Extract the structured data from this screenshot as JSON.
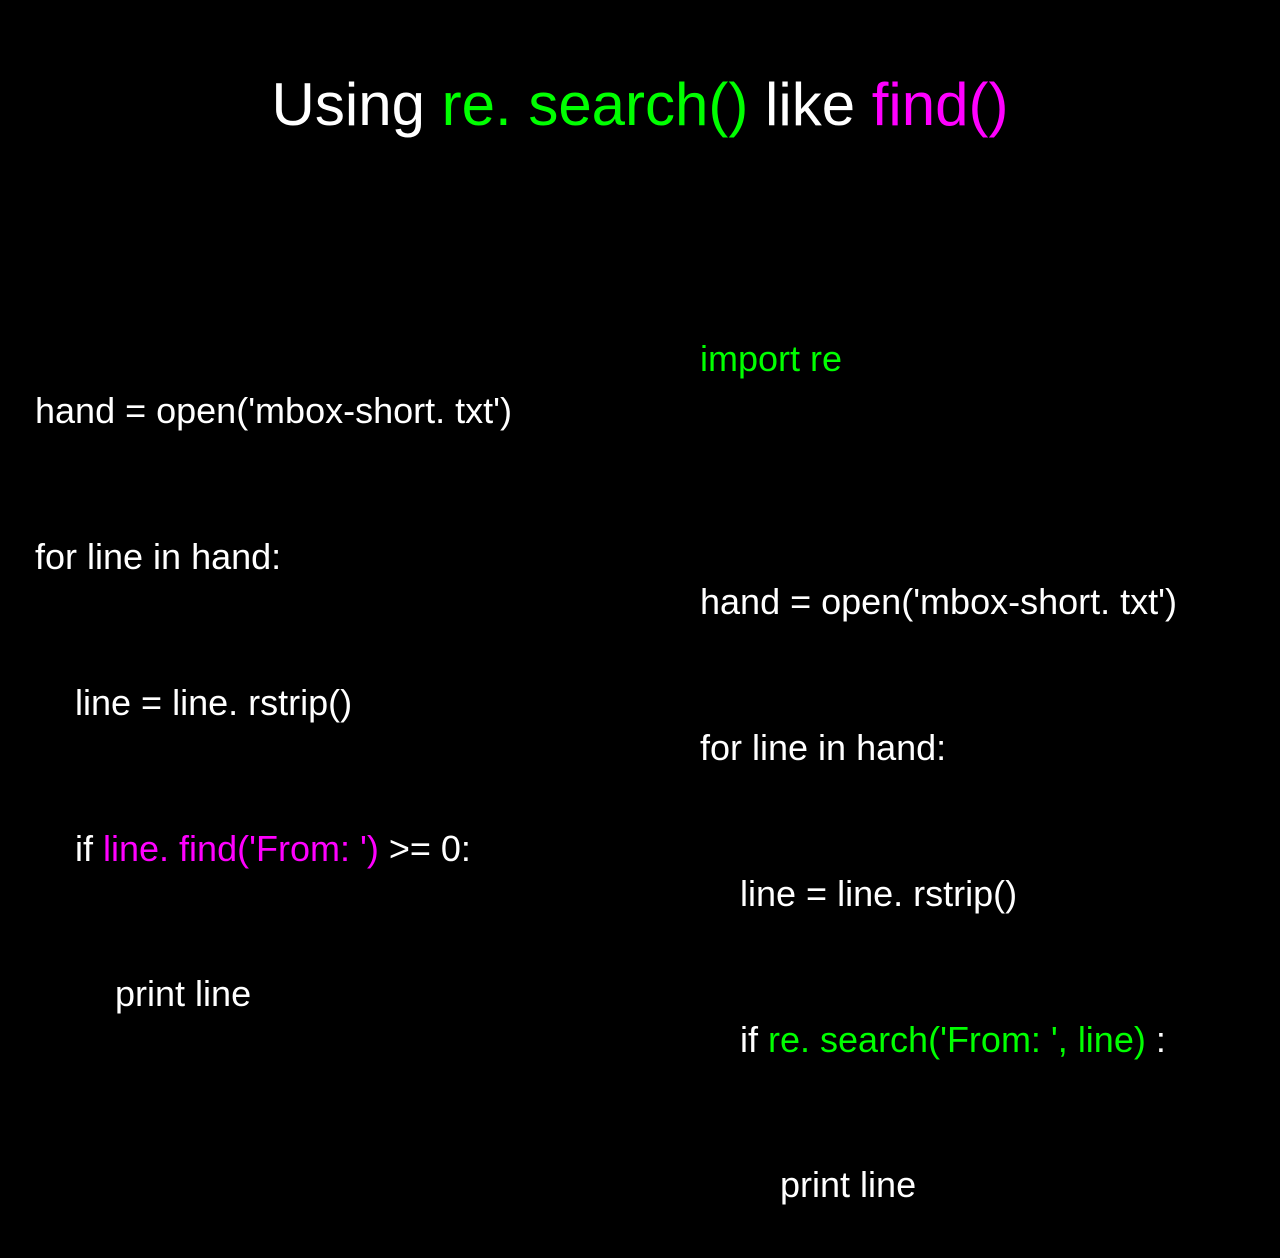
{
  "title": {
    "part1": "Using ",
    "part2": "re. search()",
    "part3": " like ",
    "part4": "find()"
  },
  "left": {
    "l1": "hand = open('mbox-short. txt')",
    "l2": "for line in hand:",
    "l3": "    line = line. rstrip()",
    "l4a": "    if ",
    "l4b": "line. find('From: ')",
    "l4c": " >= 0:",
    "l5": "        print line"
  },
  "right": {
    "l1": "import re",
    "l2": "",
    "l3": "hand = open('mbox-short. txt')",
    "l4": "for line in hand:",
    "l5": "    line = line. rstrip()",
    "l6a": "    if ",
    "l6b": "re. search('From: ', line)",
    "l6c": " :",
    "l7": "        print line"
  }
}
